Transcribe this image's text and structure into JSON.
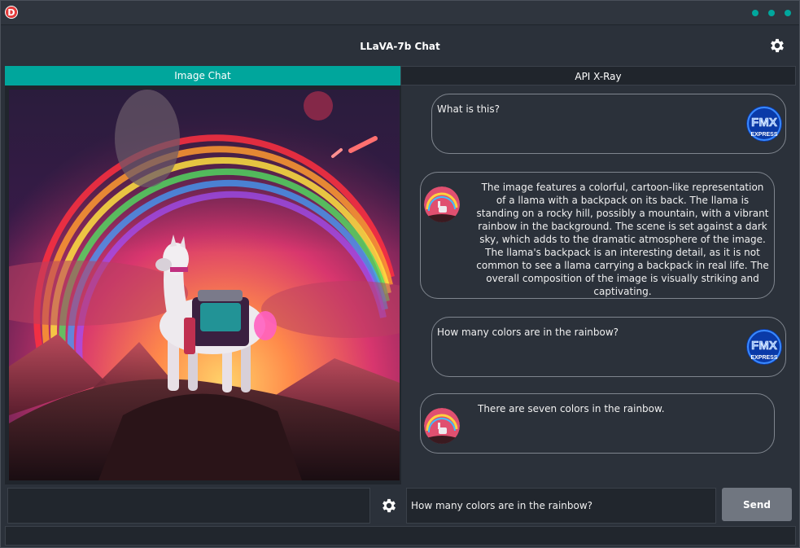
{
  "titlebar": {
    "logo_letter": "D",
    "window_dots": 3
  },
  "header": {
    "title": "LLaVA-7b Chat",
    "settings_icon": "gear-icon"
  },
  "tabs": [
    {
      "label": "Image Chat",
      "active": true
    },
    {
      "label": "API X-Ray",
      "active": false
    }
  ],
  "chat": {
    "messages": [
      {
        "role": "user",
        "text": "What is this?",
        "avatar": "fmx-express-logo"
      },
      {
        "role": "assistant",
        "text": "The image features a colorful, cartoon-like representation of a llama with a backpack on its back. The llama is standing on a rocky hill, possibly a mountain, with a vibrant rainbow in the background. The scene is set against a dark sky, which adds to the dramatic atmosphere of the image. The llama's backpack is an interesting detail, as it is not common to see a llama carrying a backpack in real life. The overall composition of the image is visually striking and  captivating.",
        "avatar": "llama-thumbnail"
      },
      {
        "role": "user",
        "text": "How many colors are in the rainbow?",
        "avatar": "fmx-express-logo"
      },
      {
        "role": "assistant",
        "text": "There are seven colors in the  rainbow.",
        "avatar": "llama-thumbnail"
      }
    ]
  },
  "avatar_logo": {
    "line1": "FMX",
    "line2": "EXPRESS"
  },
  "input": {
    "value": "How many colors are in the rainbow?",
    "settings_icon": "gear-icon"
  },
  "send_button": {
    "label": "Send"
  },
  "colors": {
    "accent": "#00a69c",
    "background": "#2b313a",
    "panel": "#20252c",
    "send": "#707680"
  }
}
